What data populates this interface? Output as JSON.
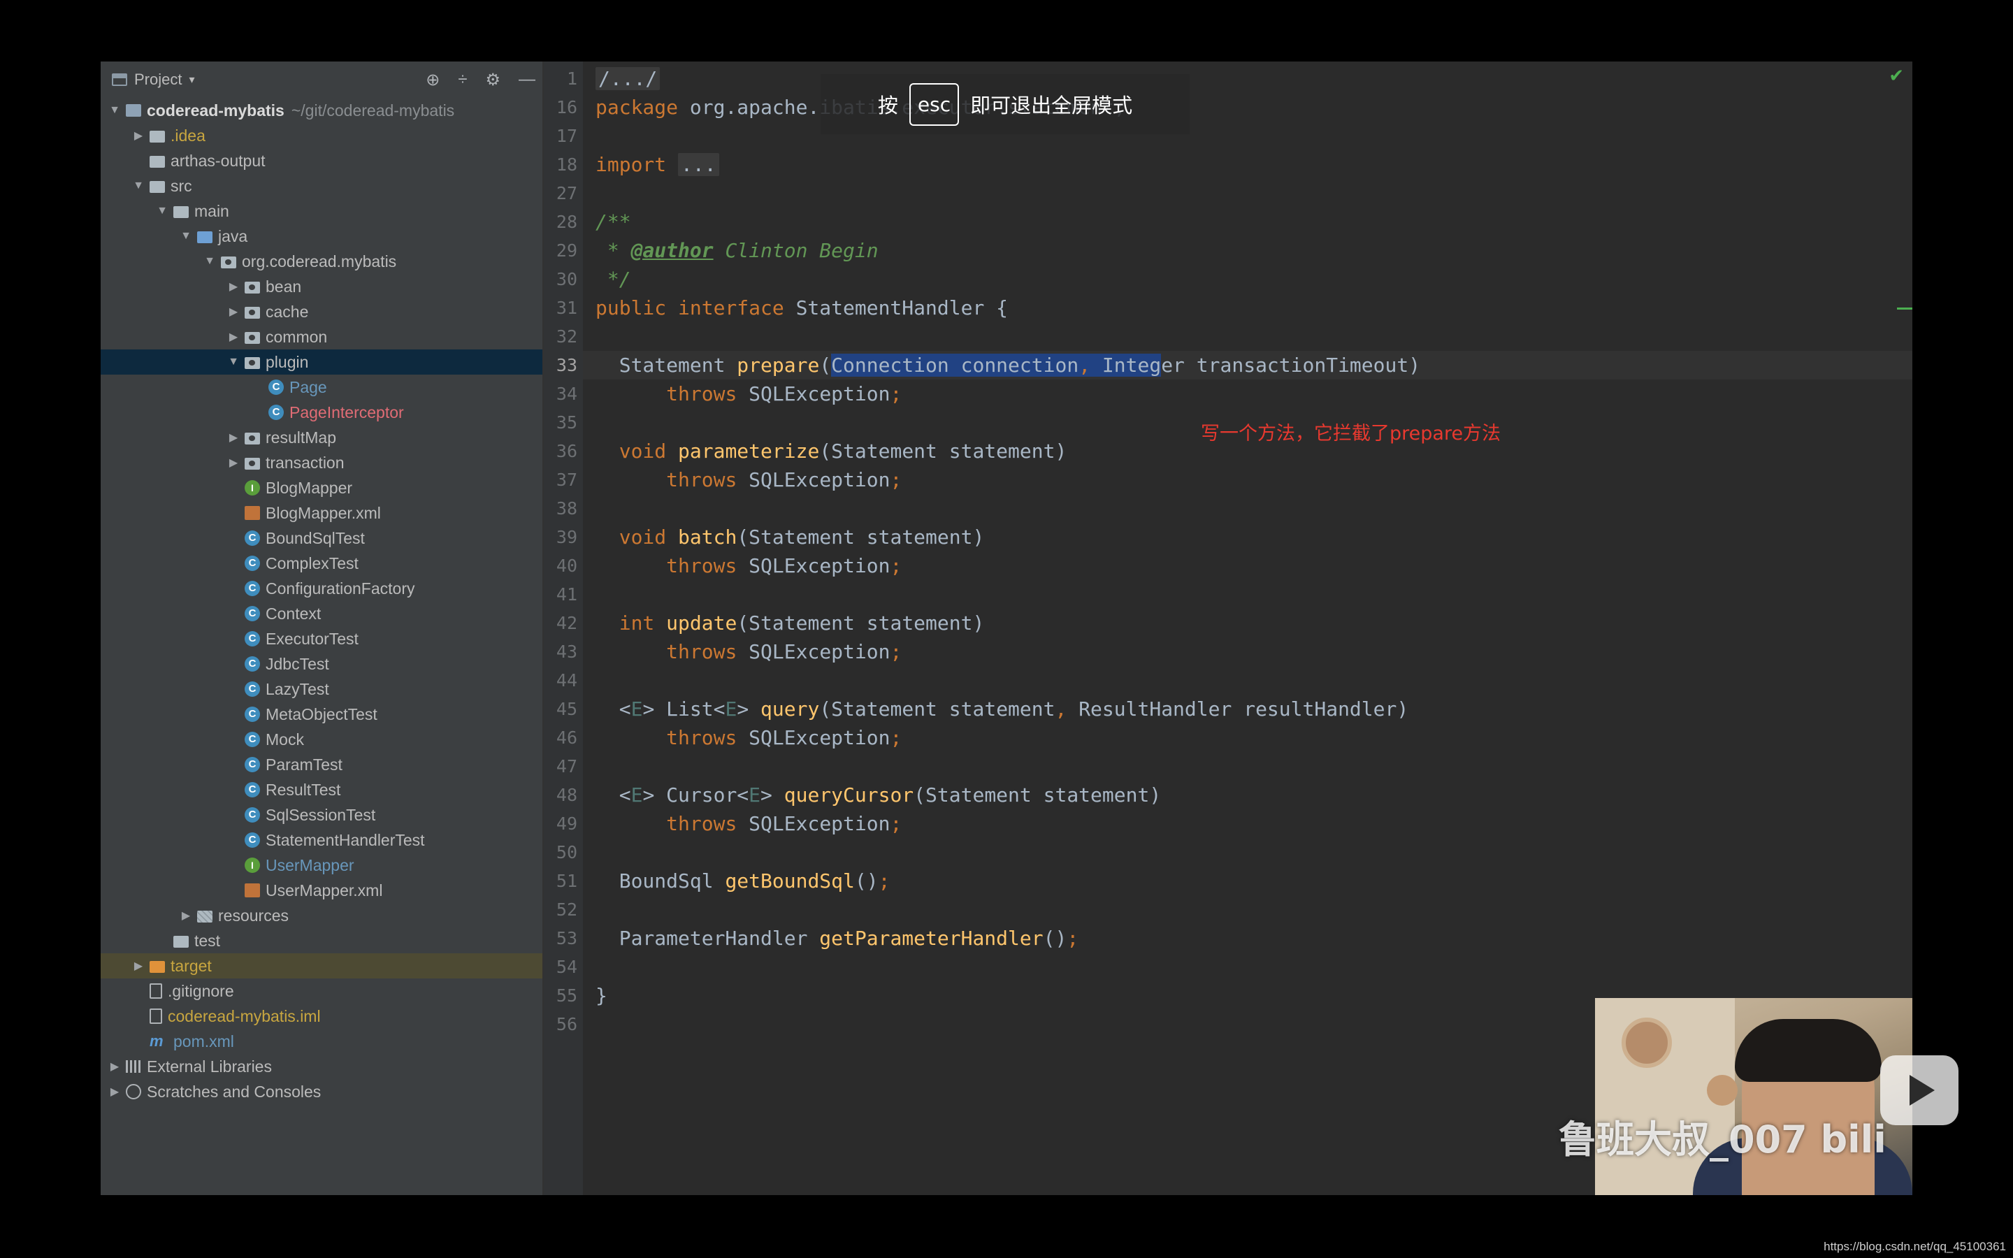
{
  "panel": {
    "title": "Project",
    "caret": "▾",
    "tools": [
      "⊕",
      "÷",
      "⚙",
      "—"
    ]
  },
  "tree": [
    {
      "arrow": "▼",
      "depth": 0,
      "icon": "module",
      "name": "coderead-mybatis",
      "extra": "~/git/coderead-mybatis",
      "style": "bold"
    },
    {
      "arrow": "▶",
      "depth": 1,
      "icon": "folder",
      "name": ".idea",
      "style": "yellow"
    },
    {
      "arrow": "",
      "depth": 1,
      "icon": "folder",
      "name": "arthas-output"
    },
    {
      "arrow": "▼",
      "depth": 1,
      "icon": "folder",
      "name": "src"
    },
    {
      "arrow": "▼",
      "depth": 2,
      "icon": "folder",
      "name": "main"
    },
    {
      "arrow": "▼",
      "depth": 3,
      "icon": "folder-blue",
      "name": "java"
    },
    {
      "arrow": "▼",
      "depth": 4,
      "icon": "package",
      "name": "org.coderead.mybatis"
    },
    {
      "arrow": "▶",
      "depth": 5,
      "icon": "package",
      "name": "bean"
    },
    {
      "arrow": "▶",
      "depth": 5,
      "icon": "package",
      "name": "cache"
    },
    {
      "arrow": "▶",
      "depth": 5,
      "icon": "package",
      "name": "common"
    },
    {
      "arrow": "▼",
      "depth": 5,
      "icon": "package",
      "name": "plugin",
      "selected": true
    },
    {
      "arrow": "",
      "depth": 6,
      "icon": "class",
      "name": "Page",
      "style": "blue"
    },
    {
      "arrow": "",
      "depth": 6,
      "icon": "class",
      "name": "PageInterceptor",
      "style": "red"
    },
    {
      "arrow": "▶",
      "depth": 5,
      "icon": "package",
      "name": "resultMap"
    },
    {
      "arrow": "▶",
      "depth": 5,
      "icon": "package",
      "name": "transaction"
    },
    {
      "arrow": "",
      "depth": 5,
      "icon": "interface",
      "name": "BlogMapper"
    },
    {
      "arrow": "",
      "depth": 5,
      "icon": "xml",
      "name": "BlogMapper.xml"
    },
    {
      "arrow": "",
      "depth": 5,
      "icon": "class",
      "name": "BoundSqlTest"
    },
    {
      "arrow": "",
      "depth": 5,
      "icon": "class",
      "name": "ComplexTest"
    },
    {
      "arrow": "",
      "depth": 5,
      "icon": "class",
      "name": "ConfigurationFactory"
    },
    {
      "arrow": "",
      "depth": 5,
      "icon": "class",
      "name": "Context"
    },
    {
      "arrow": "",
      "depth": 5,
      "icon": "class",
      "name": "ExecutorTest"
    },
    {
      "arrow": "",
      "depth": 5,
      "icon": "class",
      "name": "JdbcTest"
    },
    {
      "arrow": "",
      "depth": 5,
      "icon": "class",
      "name": "LazyTest"
    },
    {
      "arrow": "",
      "depth": 5,
      "icon": "class",
      "name": "MetaObjectTest"
    },
    {
      "arrow": "",
      "depth": 5,
      "icon": "class",
      "name": "Mock"
    },
    {
      "arrow": "",
      "depth": 5,
      "icon": "class",
      "name": "ParamTest"
    },
    {
      "arrow": "",
      "depth": 5,
      "icon": "class",
      "name": "ResultTest"
    },
    {
      "arrow": "",
      "depth": 5,
      "icon": "class",
      "name": "SqlSessionTest"
    },
    {
      "arrow": "",
      "depth": 5,
      "icon": "class",
      "name": "StatementHandlerTest"
    },
    {
      "arrow": "",
      "depth": 5,
      "icon": "interface",
      "name": "UserMapper",
      "style": "blue"
    },
    {
      "arrow": "",
      "depth": 5,
      "icon": "xml",
      "name": "UserMapper.xml"
    },
    {
      "arrow": "▶",
      "depth": 3,
      "icon": "folder-res",
      "name": "resources"
    },
    {
      "arrow": "",
      "depth": 2,
      "icon": "folder",
      "name": "test"
    },
    {
      "arrow": "▶",
      "depth": 1,
      "icon": "folder-orange",
      "name": "target",
      "style": "yellow",
      "excluded": true
    },
    {
      "arrow": "",
      "depth": 1,
      "icon": "file",
      "name": ".gitignore"
    },
    {
      "arrow": "",
      "depth": 1,
      "icon": "file",
      "name": "coderead-mybatis.iml",
      "style": "yellow"
    },
    {
      "arrow": "",
      "depth": 1,
      "icon": "maven",
      "name": "pom.xml",
      "style": "blue"
    },
    {
      "arrow": "▶",
      "depth": 0,
      "icon": "libraries",
      "name": "External Libraries"
    },
    {
      "arrow": "▶",
      "depth": 0,
      "icon": "scratches",
      "name": "Scratches and Consoles"
    }
  ],
  "editor": {
    "current_line": "33",
    "lines": [
      {
        "n": "1",
        "html": "<span class='fold'>/.../</span>"
      },
      {
        "n": "16",
        "html": "<span class='kw'>package</span> <span class='pkgname'>org.apache.ibatis.executor.statement;</span>"
      },
      {
        "n": "17",
        "html": ""
      },
      {
        "n": "18",
        "html": "<span class='kw'>import</span> <span class='fold'>...</span>"
      },
      {
        "n": "27",
        "html": ""
      },
      {
        "n": "28",
        "html": "<span class='cm'>/**</span>"
      },
      {
        "n": "29",
        "html": "<span class='cm'> * </span><span class='tag'>@author</span><span class='cm'> Clinton Begin</span>"
      },
      {
        "n": "30",
        "html": "<span class='cm'> */</span>"
      },
      {
        "n": "31",
        "html": "<span class='kw'>public interface</span> StatementHandler {"
      },
      {
        "n": "32",
        "html": ""
      },
      {
        "n": "33",
        "html": "  Statement <span class='fn'>prepare</span>(<span class='sel'>Connection connection<span class='kw'>,</span> Integ</span>er transactionTimeout)"
      },
      {
        "n": "34",
        "html": "      <span class='kw'>throws</span> SQLException<span class='kw'>;</span>"
      },
      {
        "n": "35",
        "html": ""
      },
      {
        "n": "36",
        "html": "  <span class='kw'>void</span> <span class='fn'>parameterize</span>(Statement statement)"
      },
      {
        "n": "37",
        "html": "      <span class='kw'>throws</span> SQLException<span class='kw'>;</span>"
      },
      {
        "n": "38",
        "html": ""
      },
      {
        "n": "39",
        "html": "  <span class='kw'>void</span> <span class='fn'>batch</span>(Statement statement)"
      },
      {
        "n": "40",
        "html": "      <span class='kw'>throws</span> SQLException<span class='kw'>;</span>"
      },
      {
        "n": "41",
        "html": ""
      },
      {
        "n": "42",
        "html": "  <span class='kw'>int</span> <span class='fn'>update</span>(Statement statement)"
      },
      {
        "n": "43",
        "html": "      <span class='kw'>throws</span> SQLException<span class='kw'>;</span>"
      },
      {
        "n": "44",
        "html": ""
      },
      {
        "n": "45",
        "html": "  &lt;<span class='gen'>E</span>&gt; List&lt;<span class='gen'>E</span>&gt; <span class='fn'>query</span>(Statement statement<span class='kw'>,</span> ResultHandler resultHandler)"
      },
      {
        "n": "46",
        "html": "      <span class='kw'>throws</span> SQLException<span class='kw'>;</span>"
      },
      {
        "n": "47",
        "html": ""
      },
      {
        "n": "48",
        "html": "  &lt;<span class='gen'>E</span>&gt; Cursor&lt;<span class='gen'>E</span>&gt; <span class='fn'>queryCursor</span>(Statement statement)"
      },
      {
        "n": "49",
        "html": "      <span class='kw'>throws</span> SQLException<span class='kw'>;</span>"
      },
      {
        "n": "50",
        "html": ""
      },
      {
        "n": "51",
        "html": "  BoundSql <span class='fn'>getBoundSql</span>()<span class='kw'>;</span>"
      },
      {
        "n": "52",
        "html": ""
      },
      {
        "n": "53",
        "html": "  ParameterHandler <span class='fn'>getParameterHandler</span>()<span class='kw'>;</span>"
      },
      {
        "n": "54",
        "html": ""
      },
      {
        "n": "55",
        "html": "}"
      },
      {
        "n": "56",
        "html": ""
      }
    ]
  },
  "toast": {
    "prefix": "按",
    "key": "esc",
    "suffix": "即可退出全屏模式"
  },
  "annotation": "写一个方法，它拦截了prepare方法",
  "watermark": "鲁班大叔_007 bili",
  "footer_url": "https://blog.csdn.net/qq_45100361",
  "status_check": "✔"
}
